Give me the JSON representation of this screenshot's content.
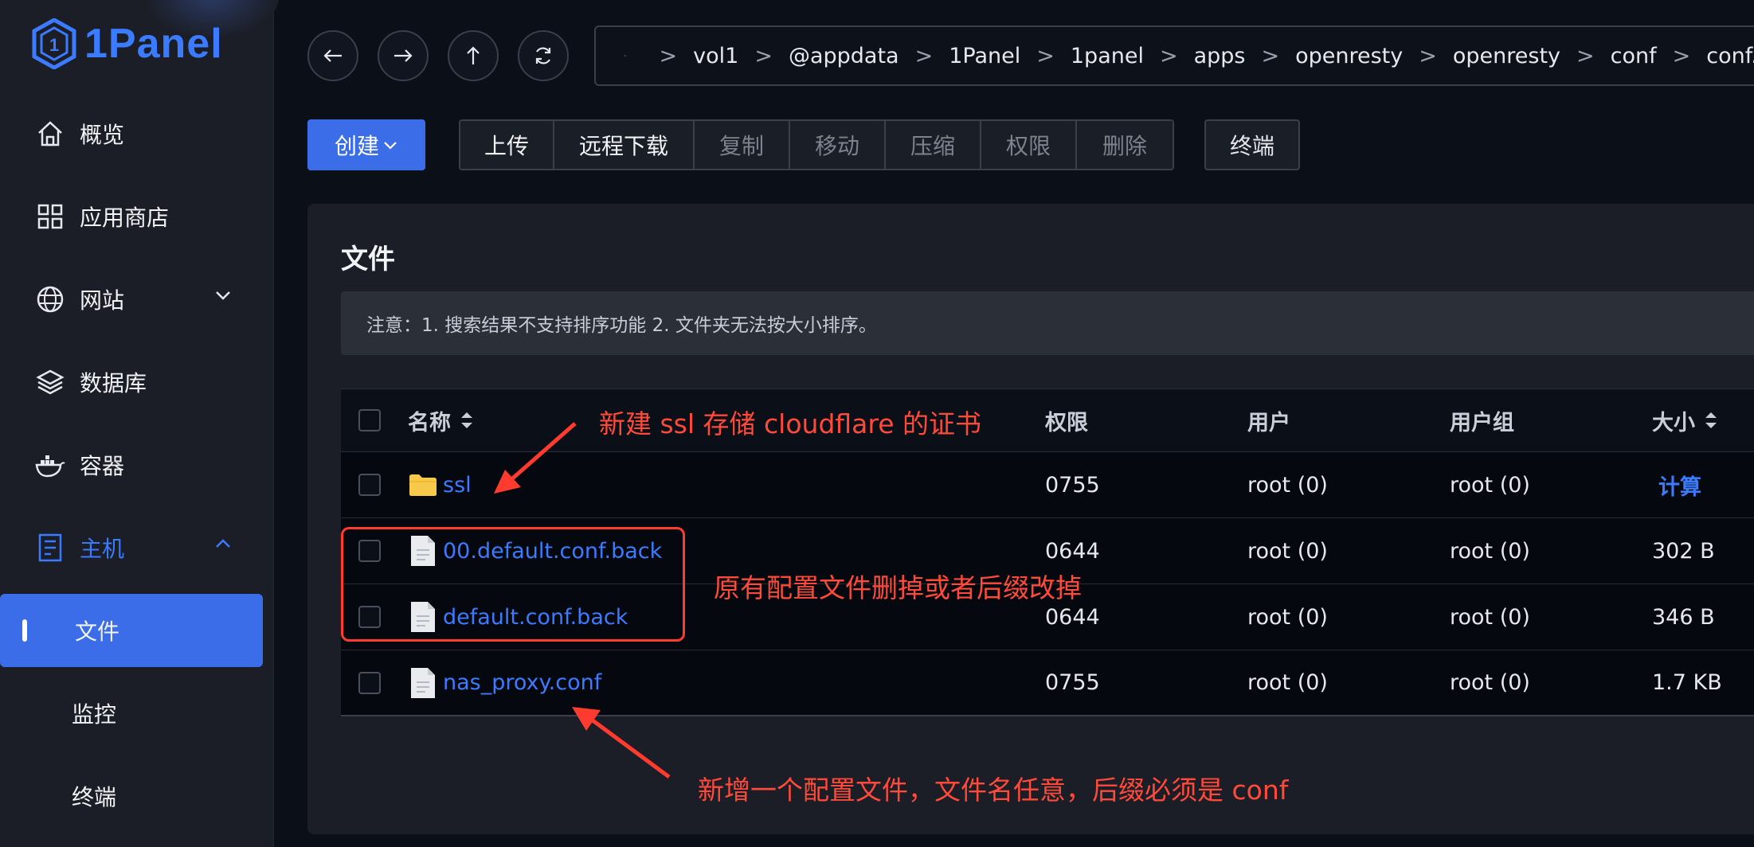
{
  "app": {
    "logo_text": "1Panel"
  },
  "sidebar": {
    "items": [
      {
        "label": "概览"
      },
      {
        "label": "应用商店"
      },
      {
        "label": "网站"
      },
      {
        "label": "数据库"
      },
      {
        "label": "容器"
      },
      {
        "label": "主机"
      }
    ],
    "sub_items": [
      {
        "label": "文件"
      },
      {
        "label": "监控"
      },
      {
        "label": "终端"
      }
    ]
  },
  "breadcrumb": [
    "vol1",
    "@appdata",
    "1Panel",
    "1panel",
    "apps",
    "openresty",
    "openresty",
    "conf",
    "conf.d"
  ],
  "toolbar": {
    "create": "创建",
    "upload": "上传",
    "remote_download": "远程下载",
    "copy": "复制",
    "move": "移动",
    "compress": "压缩",
    "permission": "权限",
    "delete": "删除",
    "terminal": "终端"
  },
  "card": {
    "title": "文件",
    "notice": "注意：1. 搜索结果不支持排序功能 2. 文件夹无法按大小排序。"
  },
  "table": {
    "headers": {
      "name": "名称",
      "permission": "权限",
      "user": "用户",
      "group": "用户组",
      "size": "大小"
    },
    "rows": [
      {
        "name": "ssl",
        "type": "folder",
        "permission": "0755",
        "user": "root (0)",
        "group": "root (0)",
        "size": "计算"
      },
      {
        "name": "00.default.conf.back",
        "type": "file",
        "permission": "0644",
        "user": "root (0)",
        "group": "root (0)",
        "size": "302 B"
      },
      {
        "name": "default.conf.back",
        "type": "file",
        "permission": "0644",
        "user": "root (0)",
        "group": "root (0)",
        "size": "346 B"
      },
      {
        "name": "nas_proxy.conf",
        "type": "file",
        "permission": "0755",
        "user": "root (0)",
        "group": "root (0)",
        "size": "1.7 KB"
      }
    ]
  },
  "annotations": {
    "ssl": "新建 ssl 存储 cloudflare 的证书",
    "remove": "原有配置文件删掉或者后缀改掉",
    "add": "新增一个配置文件，文件名任意，后缀必须是 conf"
  },
  "colors": {
    "accent": "#3b6de9",
    "link": "#3b7bff",
    "annotation": "#ff3b30",
    "folder": "#f7c948"
  }
}
